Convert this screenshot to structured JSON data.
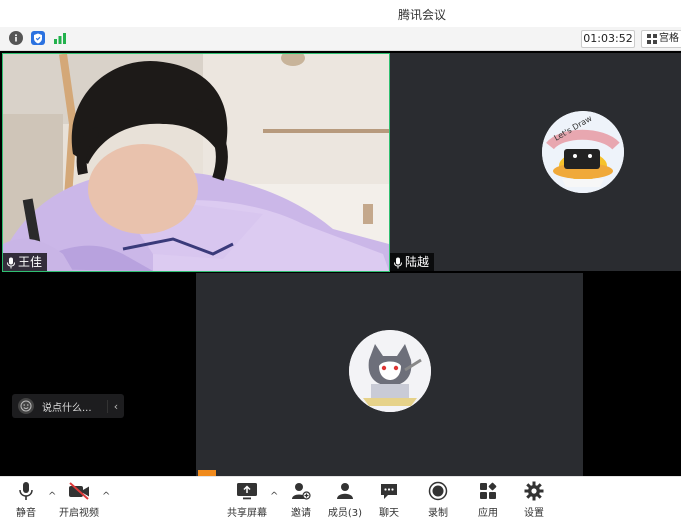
{
  "window": {
    "title": "腾讯会议"
  },
  "infobar": {
    "timer": "01:03:52",
    "gallery_label": "宫格"
  },
  "participants": [
    {
      "name": "王佳",
      "speaking": true
    },
    {
      "name": "陆越",
      "speaking": false
    }
  ],
  "chat": {
    "placeholder": "说点什么..."
  },
  "toolbar": {
    "mute": "静音",
    "video": "开启视频",
    "share": "共享屏幕",
    "invite": "邀请",
    "members": "成员(3)",
    "chat": "聊天",
    "record": "录制",
    "apps": "应用",
    "settings": "设置"
  },
  "colors": {
    "speaking_border": "#2fbf71",
    "video_off_red": "#e03a3a",
    "tile_bg": "#2a2c30"
  }
}
